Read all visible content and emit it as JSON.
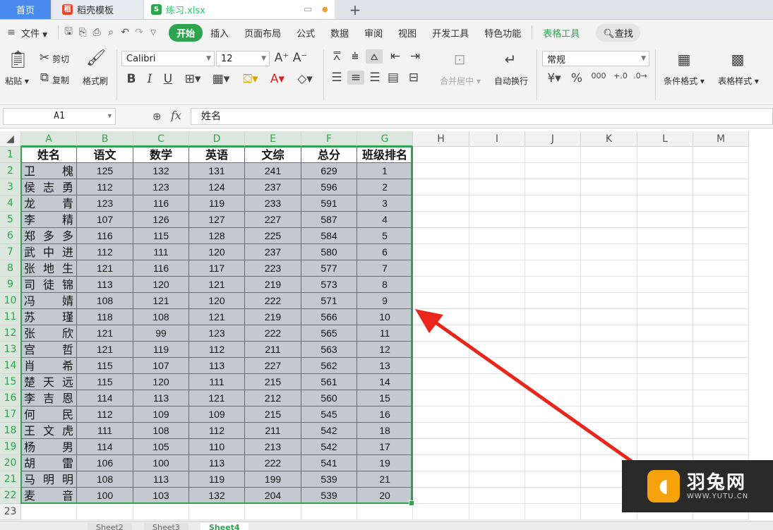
{
  "tabs": [
    {
      "label": "首页"
    },
    {
      "label": "稻壳模板",
      "icon": "wps-docer-icon"
    },
    {
      "label": "练习.xlsx",
      "icon": "spreadsheet-icon"
    }
  ],
  "menu": {
    "file": "文件",
    "items": [
      "开始",
      "插入",
      "页面布局",
      "公式",
      "数据",
      "审阅",
      "视图",
      "开发工具",
      "特色功能"
    ],
    "active": "开始",
    "table_tools": "表格工具",
    "search": "查找"
  },
  "ribbon": {
    "paste": "粘贴",
    "cut": "剪切",
    "copy": "复制",
    "format_painter": "格式刷",
    "font_name": "Calibri",
    "font_size": "12",
    "bold": "B",
    "italic": "I",
    "underline": "U",
    "merge_center": "合并居中",
    "wrap_text": "自动换行",
    "number_format": "常规",
    "percent": "%",
    "thousands": "000",
    "conditional_format": "条件格式",
    "table_style": "表格样式"
  },
  "formula_bar": {
    "name_box": "A1",
    "fx": "fx",
    "content": "姓名"
  },
  "grid": {
    "columns": [
      "A",
      "B",
      "C",
      "D",
      "E",
      "F",
      "G",
      "H",
      "I",
      "J",
      "K",
      "L",
      "M"
    ],
    "rows": [
      "1",
      "2",
      "3",
      "4",
      "5",
      "6",
      "7",
      "8",
      "9",
      "10",
      "11",
      "12",
      "13",
      "14",
      "15",
      "16",
      "17",
      "18",
      "19",
      "20",
      "21",
      "22",
      "23"
    ],
    "headers": [
      "姓名",
      "语文",
      "数学",
      "英语",
      "文综",
      "总分",
      "班级排名"
    ],
    "data": [
      [
        "卫槐",
        "125",
        "132",
        "131",
        "241",
        "629",
        "1"
      ],
      [
        "侯志勇",
        "112",
        "123",
        "124",
        "237",
        "596",
        "2"
      ],
      [
        "龙青",
        "123",
        "116",
        "119",
        "233",
        "591",
        "3"
      ],
      [
        "李精",
        "107",
        "126",
        "127",
        "227",
        "587",
        "4"
      ],
      [
        "郑多多",
        "116",
        "115",
        "128",
        "225",
        "584",
        "5"
      ],
      [
        "武中进",
        "112",
        "111",
        "120",
        "237",
        "580",
        "6"
      ],
      [
        "张地生",
        "121",
        "116",
        "117",
        "223",
        "577",
        "7"
      ],
      [
        "司徒锦",
        "113",
        "120",
        "121",
        "219",
        "573",
        "8"
      ],
      [
        "冯婧",
        "108",
        "121",
        "120",
        "222",
        "571",
        "9"
      ],
      [
        "苏瑾",
        "118",
        "108",
        "121",
        "219",
        "566",
        "10"
      ],
      [
        "张欣",
        "121",
        "99",
        "123",
        "222",
        "565",
        "11"
      ],
      [
        "宫哲",
        "121",
        "119",
        "112",
        "211",
        "563",
        "12"
      ],
      [
        "肖希",
        "115",
        "107",
        "113",
        "227",
        "562",
        "13"
      ],
      [
        "楚天远",
        "115",
        "120",
        "111",
        "215",
        "561",
        "14"
      ],
      [
        "李吉恩",
        "114",
        "113",
        "121",
        "212",
        "560",
        "15"
      ],
      [
        "何民",
        "112",
        "109",
        "109",
        "215",
        "545",
        "16"
      ],
      [
        "王文虎",
        "111",
        "108",
        "112",
        "211",
        "542",
        "18"
      ],
      [
        "杨男",
        "114",
        "105",
        "110",
        "213",
        "542",
        "17"
      ],
      [
        "胡雷",
        "106",
        "100",
        "113",
        "222",
        "541",
        "19"
      ],
      [
        "马明明",
        "108",
        "113",
        "119",
        "199",
        "539",
        "21"
      ],
      [
        "麦音",
        "100",
        "103",
        "132",
        "204",
        "539",
        "20"
      ]
    ]
  },
  "sheets": [
    "Sheet2",
    "Sheet3",
    "Sheet4"
  ],
  "active_sheet": "Sheet4",
  "colors": {
    "accent_green": "#2fa44f",
    "selection_fill": "#c3c8d1",
    "arrow": "#e8261c",
    "watermark_logo": "#f5a20d"
  },
  "watermark": {
    "name": "羽兔网",
    "url": "WWW.YUTU.CN"
  }
}
